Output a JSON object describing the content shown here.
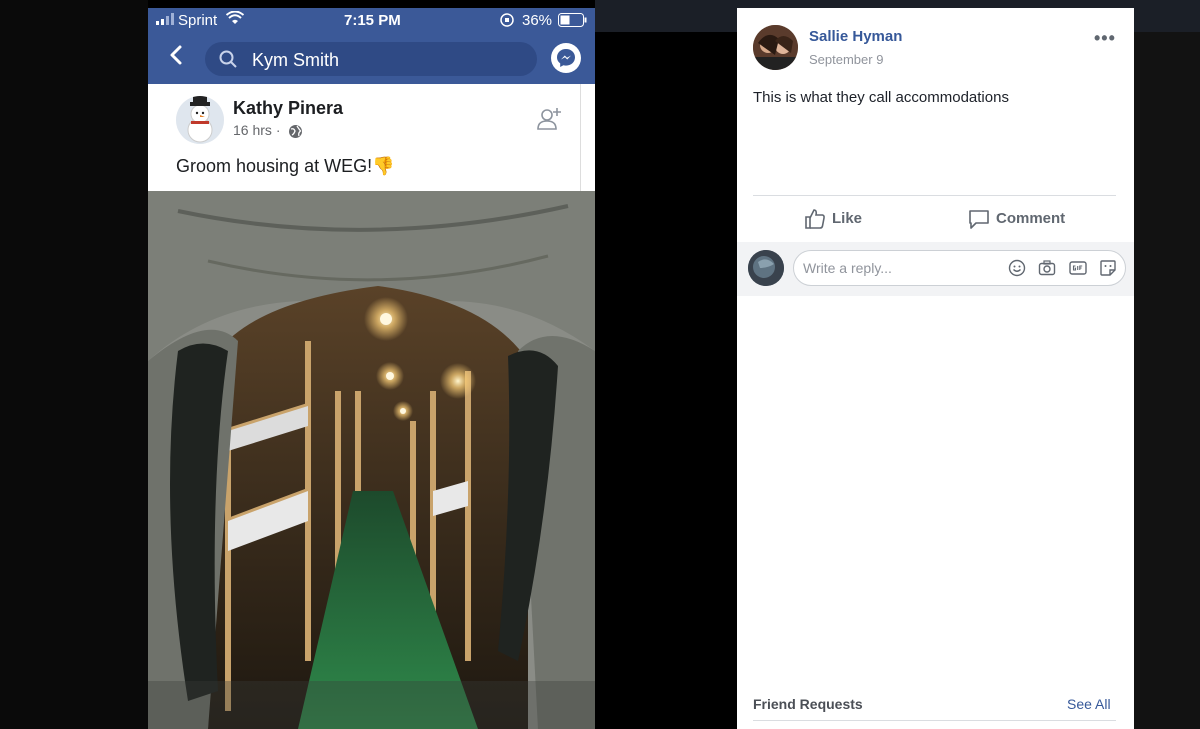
{
  "phone": {
    "status_bar": {
      "carrier": "Sprint",
      "time": "7:15 PM",
      "battery": "36%"
    },
    "search": {
      "query": "Kym Smith"
    },
    "post": {
      "author": "Kathy Pinera",
      "time": "16 hrs",
      "separator": "·",
      "text": "Groom housing at WEG!",
      "emoji": "👎"
    }
  },
  "comment": {
    "author": "Sallie Hyman",
    "date": "September 9",
    "more": "•••",
    "text": "This is what they call accommodations",
    "like_label": "Like",
    "comment_label": "Comment",
    "reply_placeholder": "Write a reply..."
  },
  "sidebar": {
    "friend_requests_label": "Friend Requests",
    "see_all_label": "See All"
  },
  "colors": {
    "facebook_blue": "#3b5998",
    "link_blue": "#365899"
  },
  "icons": [
    "back-icon",
    "search-icon",
    "messenger-icon",
    "add-friend-icon",
    "globe-icon",
    "like-icon",
    "comment-icon",
    "emoji-icon",
    "camera-icon",
    "gif-icon",
    "sticker-icon"
  ]
}
